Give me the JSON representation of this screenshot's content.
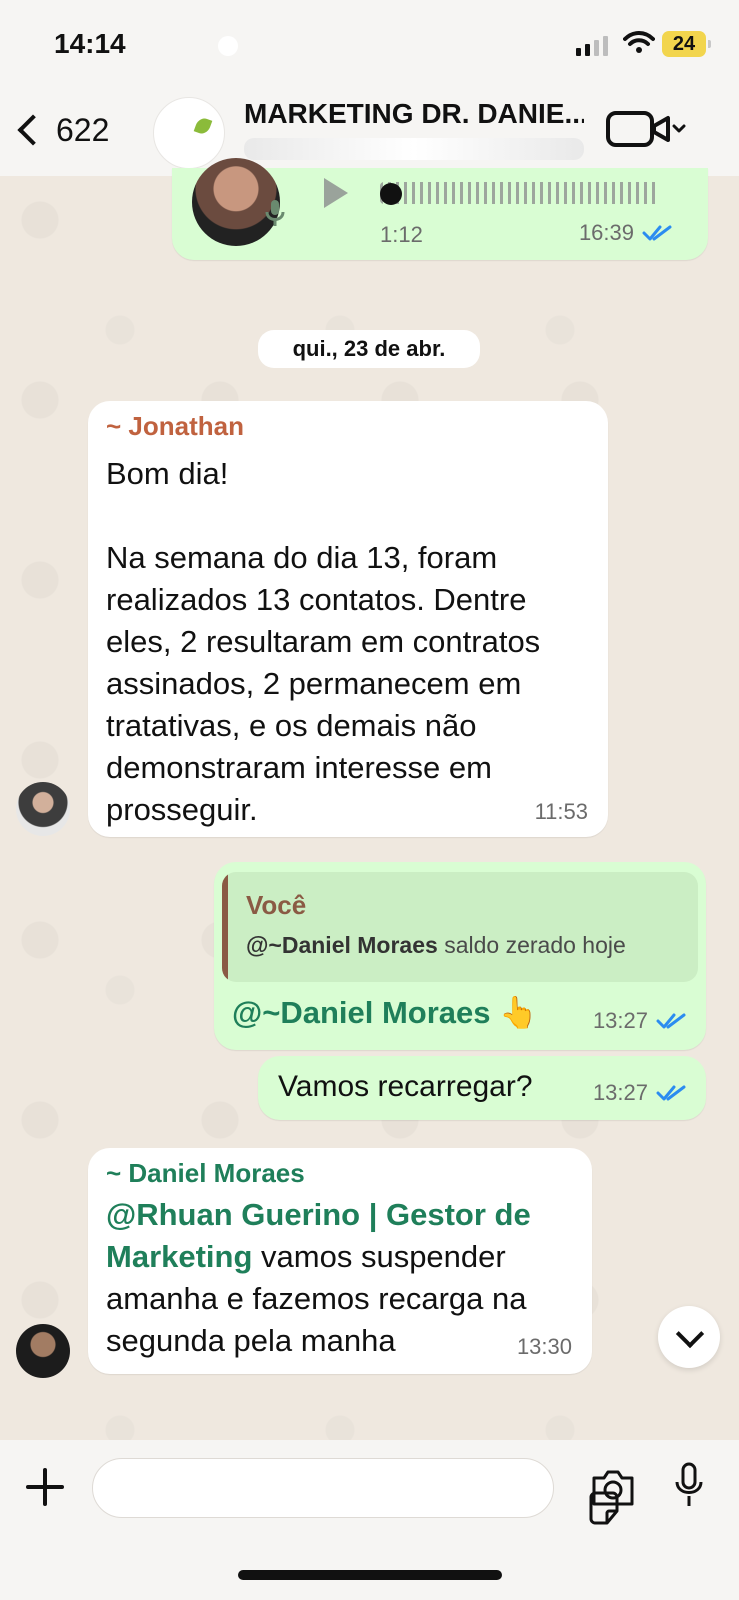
{
  "status_bar": {
    "time": "14:14",
    "battery": "24"
  },
  "header": {
    "back_count": "622",
    "title": "MARKETING DR. DANIE..."
  },
  "messages": {
    "voice": {
      "duration": "1:12",
      "time": "16:39"
    },
    "date_divider": "qui., 23 de abr.",
    "jonathan": {
      "author": "~ Jonathan",
      "text": "Bom dia!\n\nNa semana do dia 13, foram realizados 13 contatos. Dentre eles, 2 resultaram em contratos assinados, 2 permanecem em tratativas, e os demais não demonstraram interesse em prosseguir.",
      "time": "11:53"
    },
    "reply": {
      "quoted_author": "Você",
      "quoted_mention": "@~Daniel Moraes",
      "quoted_text": " saldo zerado hoje",
      "mention": "@~Daniel Moraes 👆",
      "time": "13:27"
    },
    "recarregar": {
      "text": "Vamos recarregar?",
      "time": "13:27"
    },
    "daniel": {
      "author": "~ Daniel Moraes",
      "mention": "@Rhuan Guerino | Gestor de Marketing",
      "text": " vamos suspender amanha e fazemos recarga na segunda pela manha",
      "time": "13:30"
    }
  },
  "composer": {
    "placeholder": ""
  },
  "colors": {
    "accent_green": "#1f7f5a",
    "bubble_out": "#d9fdd3",
    "bubble_in": "#ffffff",
    "reply_author": "#8a5a44",
    "battery": "#f2d54d"
  }
}
